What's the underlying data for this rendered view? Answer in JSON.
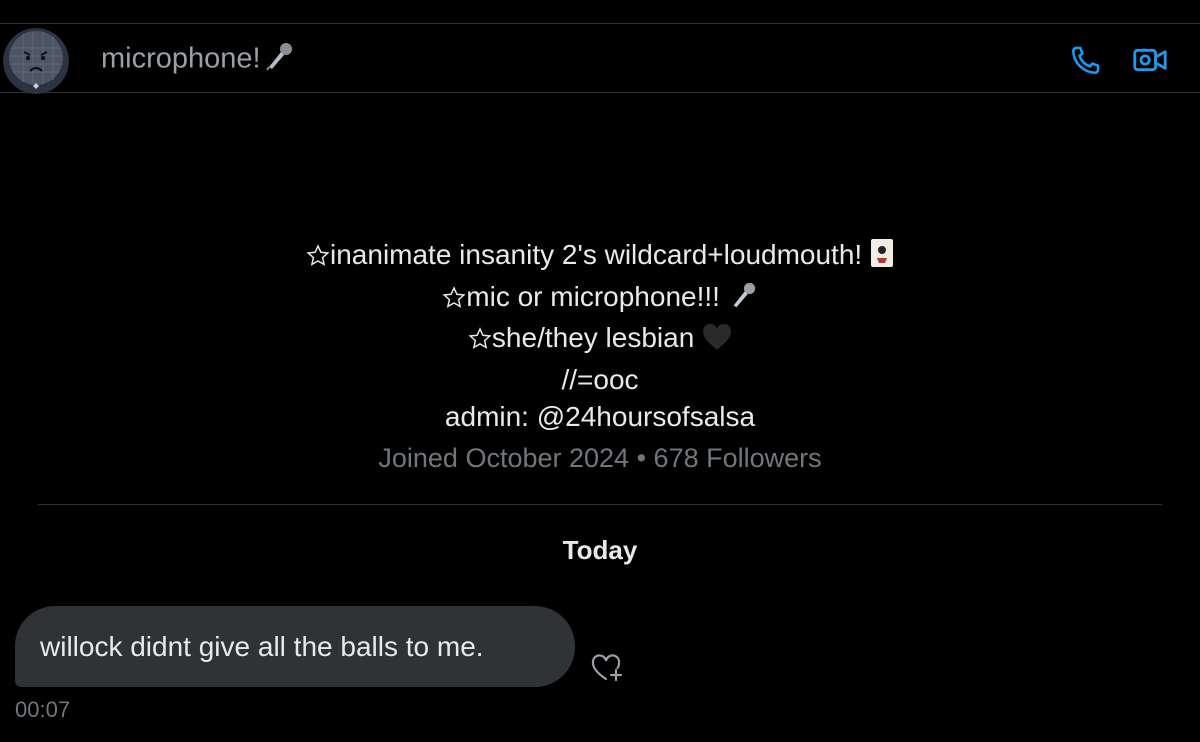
{
  "header": {
    "title": "microphone!",
    "call_icon": "phone-icon",
    "video_icon": "video-camera-icon",
    "accent_color": "#1d9bf0"
  },
  "profile": {
    "bio_lines": [
      "inanimate insanity 2's wildcard+loudmouth!",
      "mic or microphone!!!",
      "she/they lesbian",
      "//=ooc",
      "admin: @24hoursofsalsa"
    ],
    "bio_icons": [
      "star-icon",
      "joker-card-icon",
      "microphone-icon",
      "black-heart-icon"
    ],
    "joined": "Joined October 2024",
    "dot": "•",
    "followers": "678 Followers"
  },
  "conversation": {
    "date_label": "Today",
    "messages": [
      {
        "text": "willock didnt give all the balls to me.",
        "time": "00:07"
      }
    ]
  }
}
